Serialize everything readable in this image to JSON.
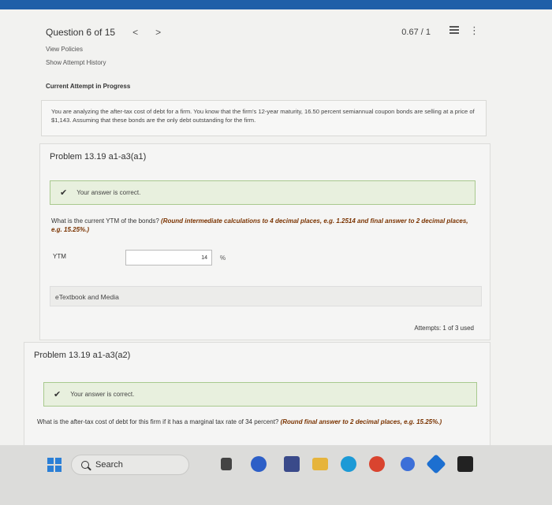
{
  "header": {
    "question_label": "Question 6 of 15",
    "prev_arrow": "<",
    "next_arrow": ">",
    "score": "0.67 / 1",
    "more": "⋮"
  },
  "links": {
    "view_policies": "View Policies",
    "show_attempt_history": "Show Attempt History"
  },
  "current_attempt": "Current Attempt in Progress",
  "question_text": "You are analyzing the after-tax cost of debt for a firm. You know that the firm's 12-year maturity, 16.50 percent semiannual coupon bonds are selling at a price of $1,143. Assuming that these bonds are the only debt outstanding for the firm.",
  "problem1": {
    "title": "Problem 13.19 a1-a3(a1)",
    "correct_msg": "Your answer is correct.",
    "prompt": "What is the current YTM of the bonds?",
    "instruction": "(Round intermediate calculations to 4 decimal places, e.g. 1.2514 and final answer to 2 decimal places, e.g. 15.25%.)",
    "ytm_label": "YTM",
    "ytm_value": "14",
    "unit": "%",
    "etextbook": "eTextbook and Media",
    "attempts": "Attempts: 1 of 3 used"
  },
  "problem2": {
    "title": "Problem 13.19 a1-a3(a2)",
    "correct_msg": "Your answer is correct.",
    "prompt": "What is the after-tax cost of debt for this firm if it has a marginal tax rate of 34 percent?",
    "instruction": "(Round final answer to 2 decimal places, e.g. 15.25%.)"
  },
  "taskbar": {
    "search_label": "Search",
    "icons": [
      "file-explorer-icon",
      "camera-icon",
      "store-icon",
      "folder-icon",
      "edge-icon",
      "chrome-icon",
      "copilot-icon",
      "mail-icon",
      "terminal-icon"
    ]
  },
  "colors": {
    "correct_bg": "#e8f0de",
    "correct_border": "#a8c98e",
    "instruction_text": "#7a3300",
    "windows_blue": "#2b7fd6"
  }
}
